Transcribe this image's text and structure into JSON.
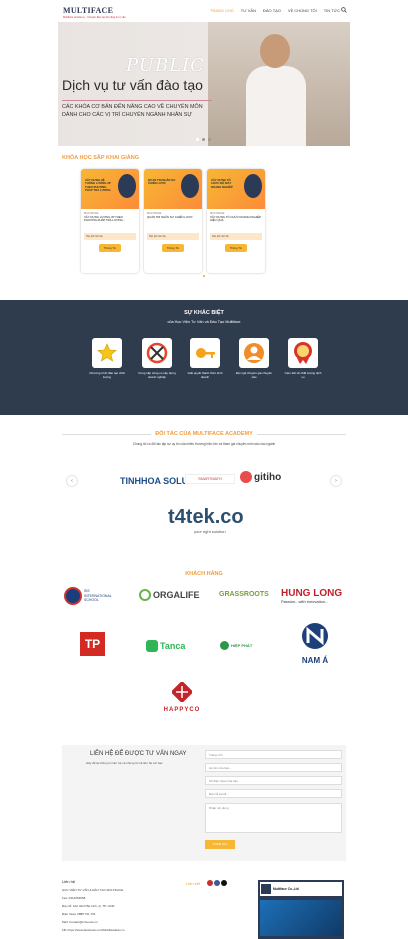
{
  "header": {
    "logo_text": "MULTIFACE",
    "logo_tagline": "Multiface Academy - Chuyên đào tạo kỹ năng & tư vấn",
    "nav": [
      "TRANG CHỦ",
      "TƯ VẤN",
      "ĐÀO TẠO",
      "VỀ CHÚNG TÔI",
      "TIN TỨC"
    ],
    "search_icon": "search-icon"
  },
  "hero": {
    "public": "PUBLIC",
    "title": "Dịch vụ tư vấn đào tạo",
    "sub1": "CÁC KHÓA CƠ BẢN ĐẾN NÂNG CAO VỀ CHUYÊN MÔN",
    "sub2": "DÀNH CHO CÁC VỊ TRÍ CHUYÊN NGÀNH NHÂN SỰ"
  },
  "courses": {
    "title": "KHÓA HỌC SẮP KHAI GIẢNG",
    "items": [
      {
        "img_title": "XÂY DỰNG HỆ THỐNG LƯƠNG 3P THEO PHƯƠNG PHÁP TRẢ LƯƠNG",
        "category": "MULTIFACE",
        "name": "XÂY DỰNG LƯƠNG 3P THEO PHƯƠNG PHÁP TRẢ LƯƠNG...",
        "price": "Học phí: liên hệ",
        "button": "Thông Tin"
      },
      {
        "img_title": "QUẢN TRỊ NHÂN SỰ CHIẾN LƯỢC",
        "category": "MULTIFACE",
        "name": "QUẢN TRỊ NHÂN SỰ CHIẾN LƯỢC",
        "price": "Học phí: liên hệ",
        "button": "Thông Tin"
      },
      {
        "img_title": "XÂY DỰNG TỔ CHỨC BỘ MÁY DOANH NGHIỆP",
        "category": "MULTIFACE",
        "name": "XÂY DỰNG TỔ CHỨC DOANH NGHIỆP HIỆU QUẢ",
        "price": "Học phí: liên hệ",
        "button": "Thông Tin"
      }
    ]
  },
  "difference": {
    "title": "SỰ KHÁC BIỆT",
    "subtitle": "của Học Viện Tư Vấn và Đào Tạo Multiface",
    "items": [
      {
        "icon": "star-icon",
        "caption": "Chương trình đào tạo chất lượng"
      },
      {
        "icon": "tools-icon",
        "caption": "Cung cấp công cụ xây dựng doanh nghiệp"
      },
      {
        "icon": "key-icon",
        "caption": "Giải quyết thách thức kinh doanh"
      },
      {
        "icon": "people-icon",
        "caption": "Đội ngũ chuyên gia chuyên sâu"
      },
      {
        "icon": "badge-icon",
        "caption": "Cam kết về chất lượng dịch vụ"
      }
    ]
  },
  "partners": {
    "title": "ĐỐI TÁC CỦA MULTIFACE ACADEMY",
    "subtitle": "Chúng tôi có đối tác tập sự uy tín của nhiều thương hiệu lớn và tham gia chuyên môn sâu vào ngành",
    "logos": [
      "TINHHOA SOLUTIONS",
      "SMARTMATH",
      "gitiho",
      "t4tek.co"
    ],
    "t4tek_tagline": "your right solution"
  },
  "clients": {
    "title": "KHÁCH HÀNG",
    "logos": [
      "SIS INTERNATIONAL SCHOOL",
      "ORGALIFE",
      "GRASSROOTS",
      "HUNG LONG",
      "TP",
      "Tanca",
      "HIỆP PHÁT",
      "NAM Á",
      "HAPPYCO"
    ],
    "hung_long_tagline": "Passion...with innovation..."
  },
  "contact": {
    "title": "LIÊN HỆ ĐỂ ĐƯỢC TƯ VẤN NGAY",
    "subtitle": "Hãy để lại thông tin liên hệ và chúng tôi sẽ liên hệ với bạn",
    "fields": [
      "Trang chủ",
      "Họ tên của bạn...",
      "Số điện thoại của bạn...",
      "Địa chỉ email...",
      "Nhập nội dung"
    ],
    "submit": "THAM GIA"
  },
  "footer": {
    "title": "Liên hệ",
    "lines": [
      "HỌC VIỆN TƯ VẤN & ĐÀO TẠO MULTIFACE",
      "Fax: 0314053068",
      "Địa chỉ: 102, Đinh Bộ Lĩnh, Q. TP. HCM",
      "Điện thoại: 0888 701 701",
      "Mail: Contact@mfa.edu.vn",
      "FB: https://www.facebook.com/MultifaceEdu.vn"
    ],
    "social_label": "Liên kết",
    "fb_name": "Multiface Co.,Ltd"
  }
}
